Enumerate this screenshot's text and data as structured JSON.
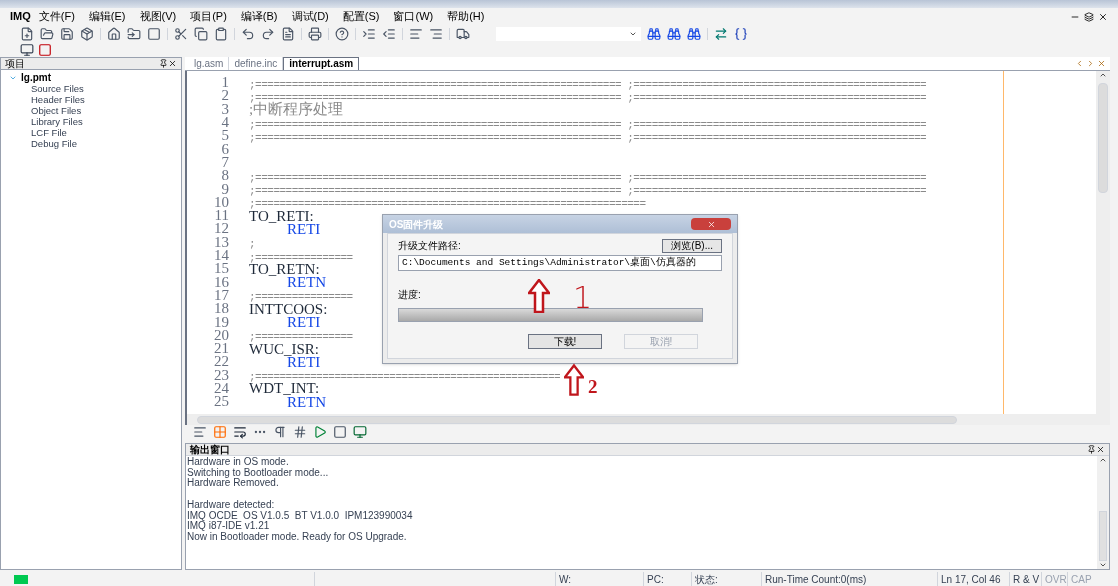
{
  "app": {
    "logo": "IMQ"
  },
  "menu": [
    "文件(F)",
    "编辑(E)",
    "视图(V)",
    "项目(P)",
    "编译(B)",
    "调试(D)",
    "配置(S)",
    "窗口(W)",
    "帮助(H)"
  ],
  "project_panel": {
    "title": "项目",
    "tree": [
      {
        "label": "lg.pmt",
        "expanded": true,
        "children": [
          {
            "label": "Source Files"
          },
          {
            "label": "Header Files"
          },
          {
            "label": "Object Files"
          },
          {
            "label": "Library Files"
          },
          {
            "label": "LCF File"
          },
          {
            "label": "Debug File"
          }
        ]
      }
    ]
  },
  "editor_tabs": [
    {
      "label": "lg.asm",
      "selected": false
    },
    {
      "label": "define.inc",
      "selected": false
    },
    {
      "label": "interrupt.asm",
      "selected": true
    }
  ],
  "code_lines": [
    {
      "number": "1",
      "kind": "comment",
      "text": ";============================================================ ;================================================"
    },
    {
      "number": "2",
      "kind": "comment",
      "text": ";============================================================ ;================================================"
    },
    {
      "number": "3",
      "kind": "heading",
      "text": ";中断程序处理"
    },
    {
      "number": "4",
      "kind": "comment",
      "text": ";============================================================ ;================================================"
    },
    {
      "number": "5",
      "kind": "comment",
      "text": ";============================================================ ;================================================"
    },
    {
      "number": "6",
      "kind": "blank"
    },
    {
      "number": "7",
      "kind": "blank"
    },
    {
      "number": "8",
      "kind": "comment",
      "text": ";============================================================ ;================================================"
    },
    {
      "number": "9",
      "kind": "comment",
      "text": ";============================================================ ;================================================"
    },
    {
      "number": "10",
      "kind": "comment",
      "text": ";================================================================"
    },
    {
      "number": "11",
      "kind": "label",
      "text": "TO_RETI:"
    },
    {
      "number": "12",
      "kind": "instruction",
      "text": "RETI"
    },
    {
      "number": "13",
      "kind": "comment",
      "text": ";"
    },
    {
      "number": "14",
      "kind": "comment",
      "text": ";================"
    },
    {
      "number": "15",
      "kind": "label",
      "text": "TO_RETN:"
    },
    {
      "number": "16",
      "kind": "instruction",
      "text": "RETN"
    },
    {
      "number": "17",
      "kind": "comment",
      "text": ";================"
    },
    {
      "number": "18",
      "kind": "label",
      "text": "INTTCOOS:"
    },
    {
      "number": "19",
      "kind": "instruction",
      "text": "RETI"
    },
    {
      "number": "20",
      "kind": "comment",
      "text": ";================"
    },
    {
      "number": "21",
      "kind": "label",
      "text": "WUC_ISR:"
    },
    {
      "number": "22",
      "kind": "instruction",
      "text": "RETI"
    },
    {
      "number": "23",
      "kind": "comment",
      "text": ";=================================================="
    },
    {
      "number": "24",
      "kind": "label",
      "text": "WDT_INT:"
    },
    {
      "number": "25",
      "kind": "instruction",
      "text": "RETN"
    }
  ],
  "dialog": {
    "title": "OS固件升级",
    "path_label": "升级文件路径:",
    "browse_button": "浏览(B)...",
    "path_value": "C:\\Documents and Settings\\Administrator\\桌面\\仿真器的",
    "progress_label": "进度:",
    "progress": {
      "level": 0
    },
    "buttons": [
      {
        "label": "下载!",
        "disabled": false
      },
      {
        "label": "取消!",
        "disabled": true
      }
    ]
  },
  "annotations": [
    {
      "label": "1"
    },
    {
      "label": "2"
    }
  ],
  "output": {
    "title": "输出窗口",
    "paragraphs": [
      [
        "Hardware in OS mode.",
        "Switching to Bootloader mode...",
        "Hardware Removed."
      ],
      [
        "Hardware detected:",
        "IMQ OCDE  OS V1.0.5  BT V1.0.0  IPM123990034",
        "IMQ i87-IDE v1.21",
        "Now in Bootloader mode. Ready for OS Upgrade."
      ]
    ]
  },
  "status_bar": {
    "connected": true,
    "fields": [
      {
        "text": "W:",
        "disabled": false
      },
      {
        "text": "PC:",
        "disabled": false
      },
      {
        "text": "状态:",
        "disabled": false
      },
      {
        "text": "Run-Time Count:0(ms)",
        "disabled": false
      },
      {
        "text": "Ln 17, Col 46",
        "disabled": false
      },
      {
        "text": "R & V",
        "disabled": false
      },
      {
        "text": "OVR",
        "disabled": true
      },
      {
        "text": "CAP",
        "disabled": true
      }
    ]
  }
}
